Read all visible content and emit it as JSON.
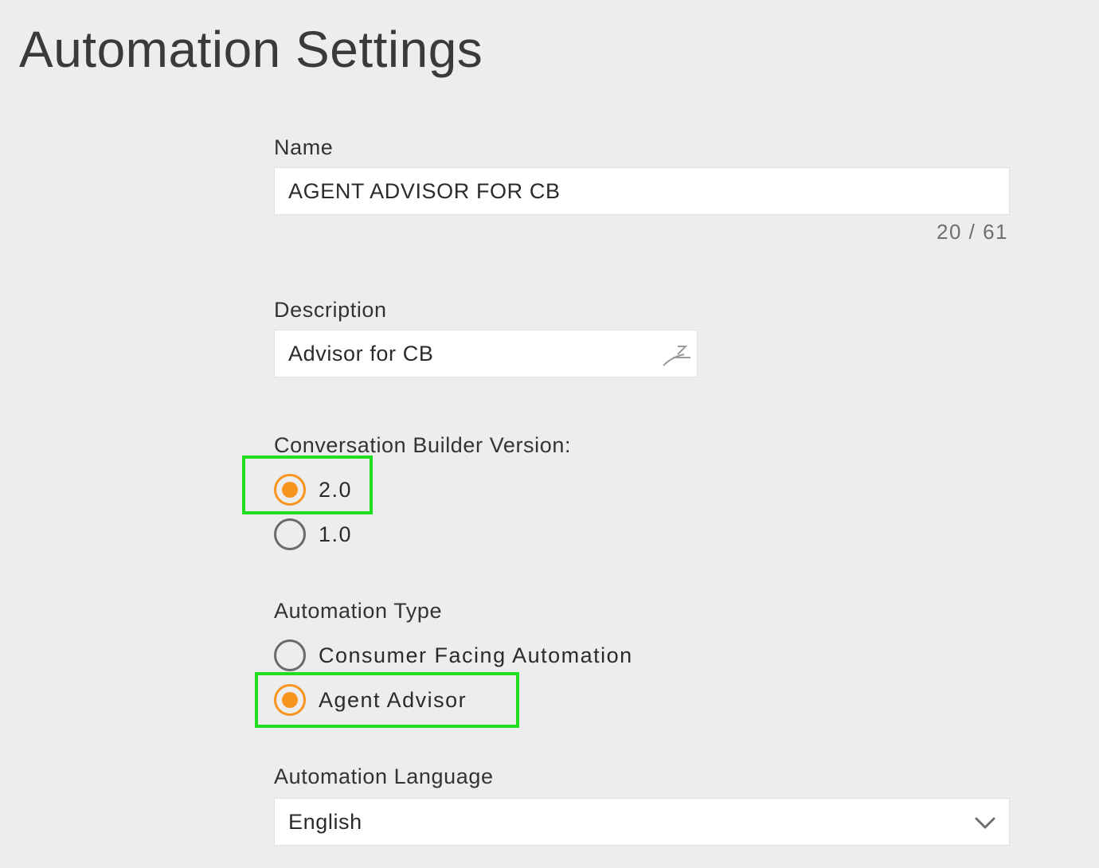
{
  "page": {
    "title": "Automation Settings"
  },
  "name_field": {
    "label": "Name",
    "value": "AGENT ADVISOR FOR CB",
    "counter": "20 / 61"
  },
  "description_field": {
    "label": "Description",
    "value": "Advisor for CB",
    "resize_icon": "resize-handle-icon"
  },
  "cb_version": {
    "label": "Conversation Builder Version:",
    "options": [
      {
        "label": "2.0",
        "selected": true,
        "highlighted": true
      },
      {
        "label": "1.0",
        "selected": false,
        "highlighted": false
      }
    ]
  },
  "automation_type": {
    "label": "Automation Type",
    "options": [
      {
        "label": "Consumer Facing Automation",
        "selected": false,
        "highlighted": false
      },
      {
        "label": "Agent Advisor",
        "selected": true,
        "highlighted": true
      }
    ]
  },
  "automation_language": {
    "label": "Automation Language",
    "selected": "English",
    "dropdown_icon": "chevron-down-icon"
  },
  "colors": {
    "background": "#ededed",
    "field_background": "#ffffff",
    "radio_selected": "#f7941d",
    "radio_unselected": "#6a6a6a",
    "highlight": "#1ee01e",
    "text": "#333333"
  }
}
